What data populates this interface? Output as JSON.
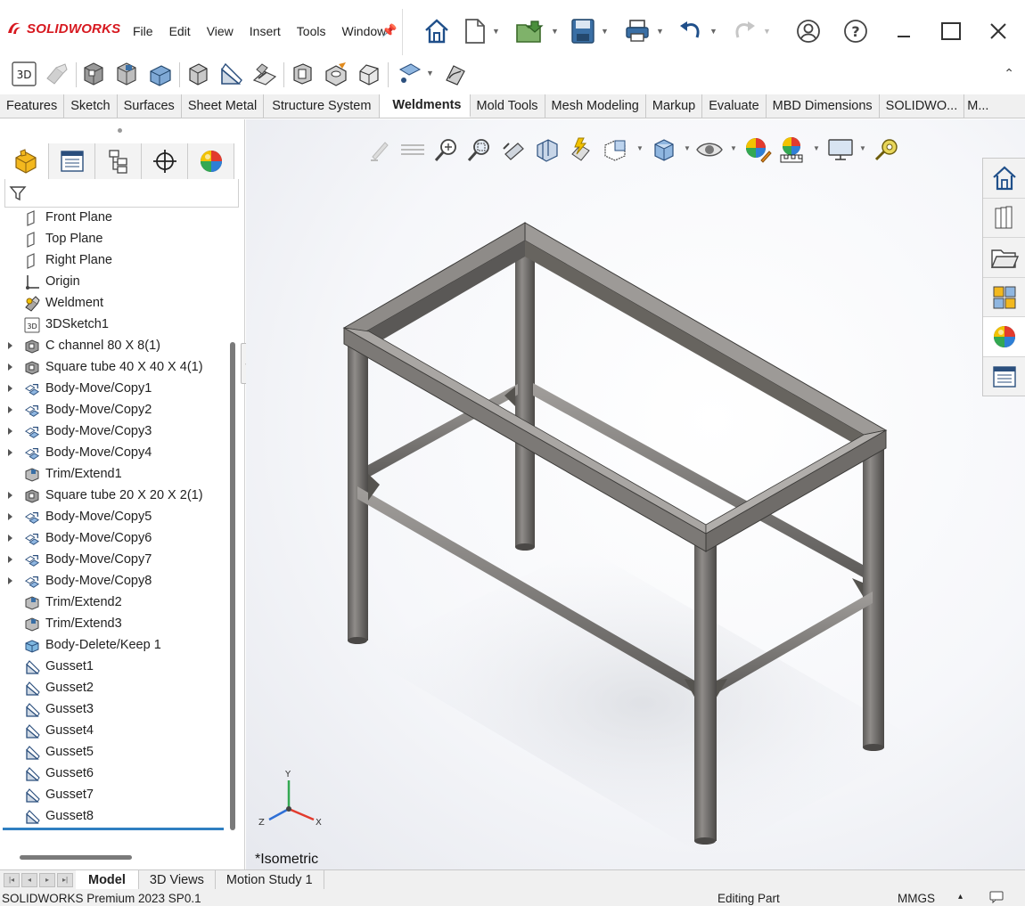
{
  "app": {
    "logo_text": "SOLIDWORKS",
    "menu": [
      "File",
      "Edit",
      "View",
      "Insert",
      "Tools",
      "Window"
    ]
  },
  "tabs": [
    "Features",
    "Sketch",
    "Surfaces",
    "Sheet Metal",
    "Structure System",
    "Weldments",
    "Mold Tools",
    "Mesh Modeling",
    "Markup",
    "Evaluate",
    "MBD Dimensions",
    "SOLIDWO...",
    "M..."
  ],
  "active_tab": "Weldments",
  "tree": [
    {
      "label": "Front Plane",
      "icon": "plane-icon",
      "expandable": false
    },
    {
      "label": "Top Plane",
      "icon": "plane-icon",
      "expandable": false
    },
    {
      "label": "Right Plane",
      "icon": "plane-icon",
      "expandable": false
    },
    {
      "label": "Origin",
      "icon": "origin-icon",
      "expandable": false
    },
    {
      "label": "Weldment",
      "icon": "weldment-icon",
      "expandable": false
    },
    {
      "label": "3DSketch1",
      "icon": "3dsketch-icon",
      "expandable": false
    },
    {
      "label": "C channel 80 X 8(1)",
      "icon": "structural-member-icon",
      "expandable": true
    },
    {
      "label": "Square tube 40 X 40 X 4(1)",
      "icon": "structural-member-icon",
      "expandable": true
    },
    {
      "label": "Body-Move/Copy1",
      "icon": "move-copy-icon",
      "expandable": true
    },
    {
      "label": "Body-Move/Copy2",
      "icon": "move-copy-icon",
      "expandable": true
    },
    {
      "label": "Body-Move/Copy3",
      "icon": "move-copy-icon",
      "expandable": true
    },
    {
      "label": "Body-Move/Copy4",
      "icon": "move-copy-icon",
      "expandable": true
    },
    {
      "label": "Trim/Extend1",
      "icon": "trim-extend-icon",
      "expandable": false
    },
    {
      "label": "Square tube 20 X 20 X 2(1)",
      "icon": "structural-member-icon",
      "expandable": true
    },
    {
      "label": "Body-Move/Copy5",
      "icon": "move-copy-icon",
      "expandable": true
    },
    {
      "label": "Body-Move/Copy6",
      "icon": "move-copy-icon",
      "expandable": true
    },
    {
      "label": "Body-Move/Copy7",
      "icon": "move-copy-icon",
      "expandable": true
    },
    {
      "label": "Body-Move/Copy8",
      "icon": "move-copy-icon",
      "expandable": true
    },
    {
      "label": "Trim/Extend2",
      "icon": "trim-extend-icon",
      "expandable": false
    },
    {
      "label": "Trim/Extend3",
      "icon": "trim-extend-icon",
      "expandable": false
    },
    {
      "label": "Body-Delete/Keep 1",
      "icon": "body-delete-icon",
      "expandable": false
    },
    {
      "label": "Gusset1",
      "icon": "gusset-icon",
      "expandable": false
    },
    {
      "label": "Gusset2",
      "icon": "gusset-icon",
      "expandable": false
    },
    {
      "label": "Gusset3",
      "icon": "gusset-icon",
      "expandable": false
    },
    {
      "label": "Gusset4",
      "icon": "gusset-icon",
      "expandable": false
    },
    {
      "label": "Gusset5",
      "icon": "gusset-icon",
      "expandable": false
    },
    {
      "label": "Gusset6",
      "icon": "gusset-icon",
      "expandable": false
    },
    {
      "label": "Gusset7",
      "icon": "gusset-icon",
      "expandable": false
    },
    {
      "label": "Gusset8",
      "icon": "gusset-icon",
      "expandable": false
    }
  ],
  "viewport": {
    "view_label": "*Isometric",
    "triad": {
      "x": "X",
      "y": "Y",
      "z": "Z"
    }
  },
  "bottom_tabs": [
    "Model",
    "3D Views",
    "Motion Study 1"
  ],
  "active_bottom_tab": "Model",
  "status": {
    "left": "SOLIDWORKS Premium 2023 SP0.1",
    "mode": "Editing Part",
    "units": "MMGS",
    "units_arrow": "▴"
  },
  "colors": {
    "brand_red": "#d71920",
    "steel": "#7c7a78",
    "accent_blue": "#2f7fc1"
  }
}
